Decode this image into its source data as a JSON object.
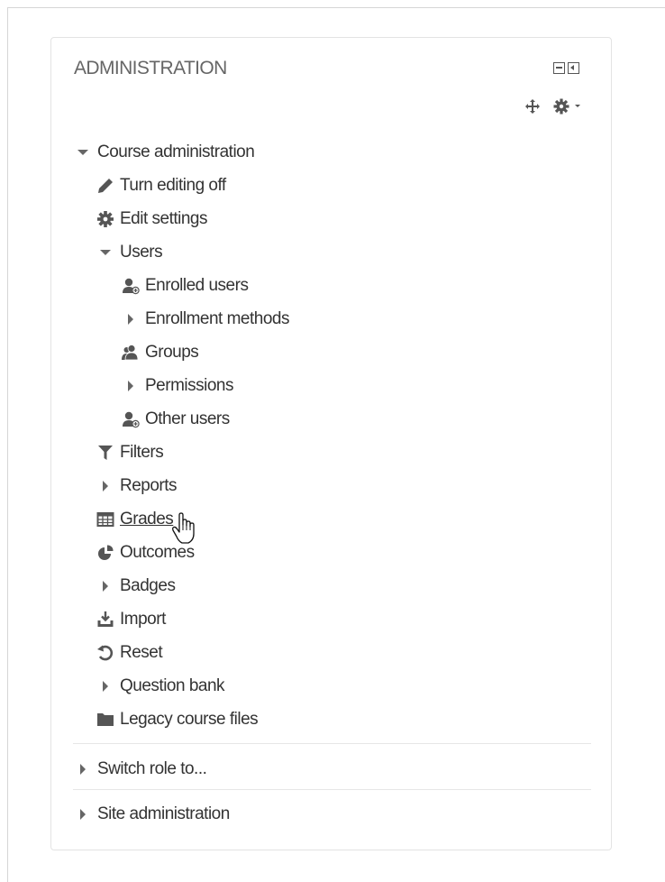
{
  "block": {
    "title": "ADMINISTRATION",
    "controls": {
      "hide_icon": "minus-box-icon",
      "dock_icon": "dock-left-icon"
    },
    "actions": {
      "move_icon": "move-arrows-icon",
      "settings_icon": "gear-dropdown-icon"
    }
  },
  "tree": {
    "course_admin": "Course administration",
    "editing": "Turn editing off",
    "edit_settings": "Edit settings",
    "users": "Users",
    "enrolled_users": "Enrolled users",
    "enrollment_methods": "Enrollment methods",
    "groups": "Groups",
    "permissions": "Permissions",
    "other_users": "Other users",
    "filters": "Filters",
    "reports": "Reports",
    "grades": "Grades",
    "outcomes": "Outcomes",
    "badges": "Badges",
    "import": "Import",
    "reset": "Reset",
    "question_bank": "Question bank",
    "legacy_files": "Legacy course files",
    "switch_role": "Switch role to...",
    "site_admin": "Site administration"
  },
  "colors": {
    "text": "#333333",
    "title": "#666666",
    "icon": "#555555",
    "border": "#e3e3e3"
  }
}
